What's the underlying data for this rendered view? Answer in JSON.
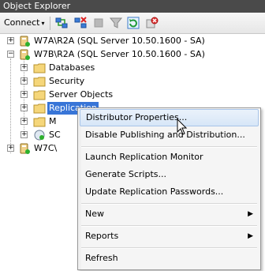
{
  "panel": {
    "title": "Object Explorer"
  },
  "toolbar": {
    "connect_label": "Connect",
    "connect_arrow": "▾",
    "icons": [
      "connect-object-explorer-icon",
      "disconnect-icon",
      "stop-icon",
      "filter-icon",
      "refresh-icon",
      "cancel-connection-icon"
    ]
  },
  "tree": {
    "server1": "W7A\\R2A (SQL Server 10.50.1600 - SA)",
    "server2": "W7B\\R2A (SQL Server 10.50.1600 - SA)",
    "folders": [
      "Databases",
      "Security",
      "Server Objects",
      "Replication",
      "M",
      "SC"
    ],
    "server3": "W7C\\"
  },
  "menu": {
    "items": [
      {
        "label": "Distributor Properties..."
      },
      {
        "label": "Disable Publishing and Distribution..."
      },
      {
        "label": "Launch Replication Monitor"
      },
      {
        "label": "Generate Scripts..."
      },
      {
        "label": "Update Replication Passwords..."
      },
      {
        "label": "New"
      },
      {
        "label": "Reports"
      },
      {
        "label": "Refresh"
      }
    ],
    "submenu_arrow": "▶"
  },
  "colors": {
    "selection": "#3875d7",
    "menu_hover": "#d7e6f7",
    "titlebar": "#4a4a4a"
  }
}
